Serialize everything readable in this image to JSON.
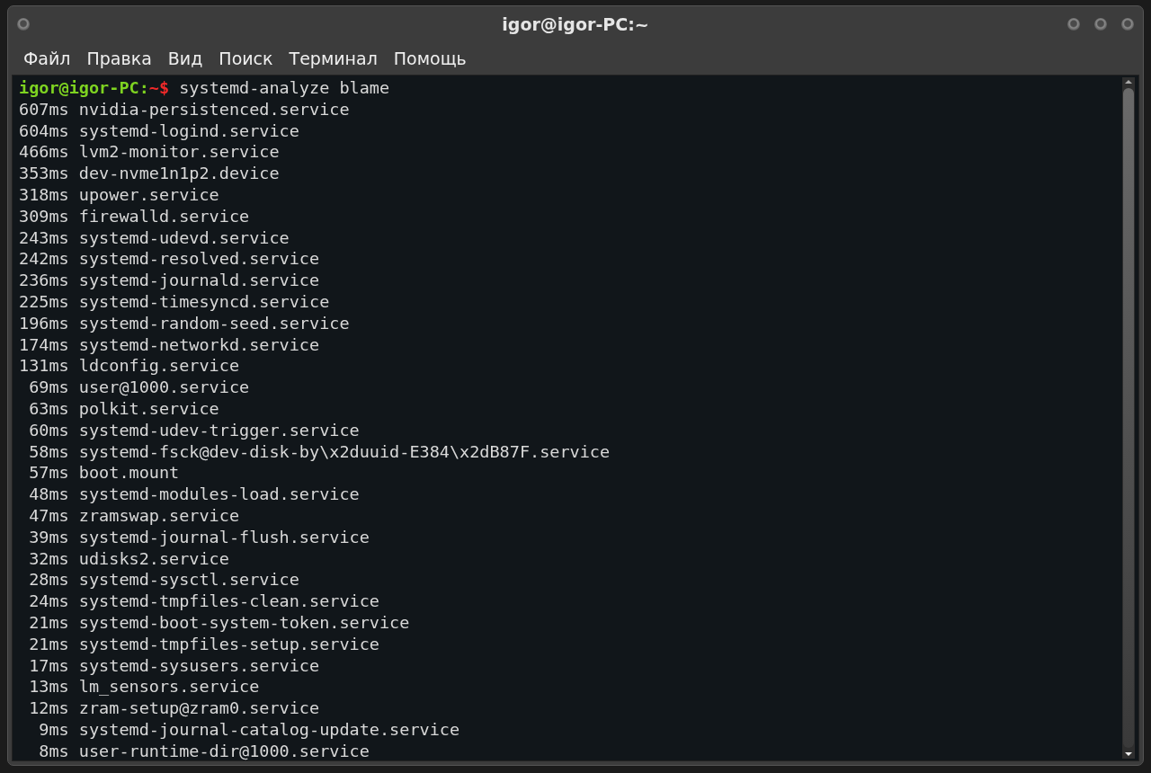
{
  "window": {
    "title": "igor@igor-PC:~"
  },
  "menu": [
    "Файл",
    "Правка",
    "Вид",
    "Поиск",
    "Терминал",
    "Помощь"
  ],
  "terminal": {
    "prompt": {
      "user_host": "igor@igor-PC:",
      "path": "~$",
      "command": "systemd-analyze blame"
    },
    "lines": [
      "607ms nvidia-persistenced.service",
      "604ms systemd-logind.service",
      "466ms lvm2-monitor.service",
      "353ms dev-nvme1n1p2.device",
      "318ms upower.service",
      "309ms firewalld.service",
      "243ms systemd-udevd.service",
      "242ms systemd-resolved.service",
      "236ms systemd-journald.service",
      "225ms systemd-timesyncd.service",
      "196ms systemd-random-seed.service",
      "174ms systemd-networkd.service",
      "131ms ldconfig.service",
      " 69ms user@1000.service",
      " 63ms polkit.service",
      " 60ms systemd-udev-trigger.service",
      " 58ms systemd-fsck@dev-disk-by\\x2duuid-E384\\x2dB87F.service",
      " 57ms boot.mount",
      " 48ms systemd-modules-load.service",
      " 47ms zramswap.service",
      " 39ms systemd-journal-flush.service",
      " 32ms udisks2.service",
      " 28ms systemd-sysctl.service",
      " 24ms systemd-tmpfiles-clean.service",
      " 21ms systemd-boot-system-token.service",
      " 21ms systemd-tmpfiles-setup.service",
      " 17ms systemd-sysusers.service",
      " 13ms lm_sensors.service",
      " 12ms zram-setup@zram0.service",
      "  9ms systemd-journal-catalog-update.service",
      "  8ms user-runtime-dir@1000.service"
    ]
  }
}
